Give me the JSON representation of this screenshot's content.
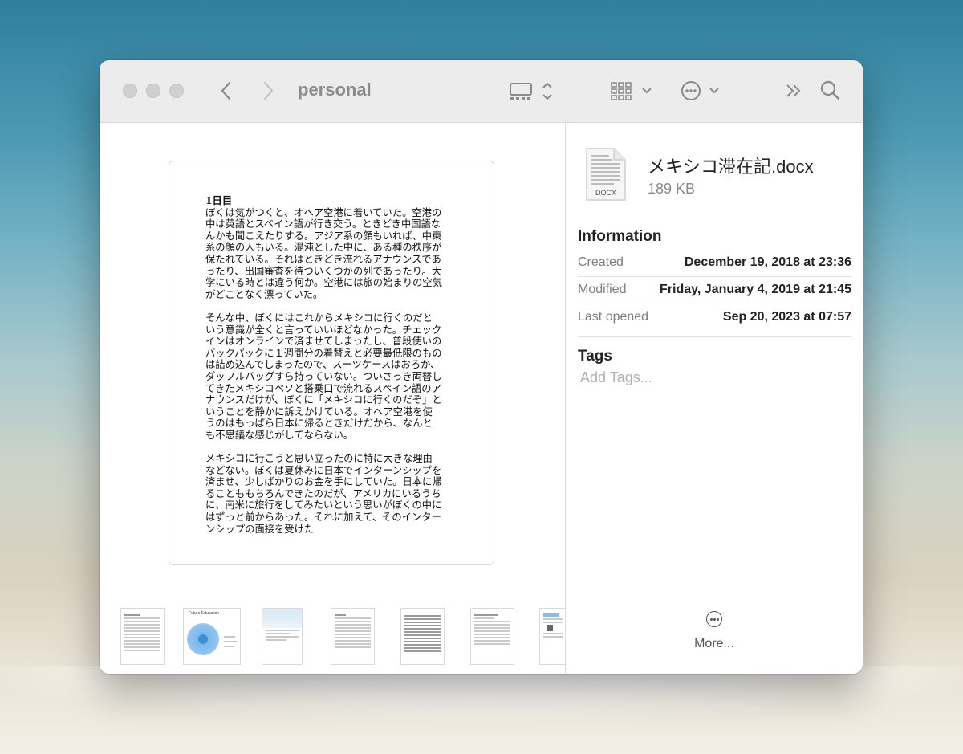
{
  "window": {
    "title": "personal"
  },
  "toolbar": {
    "back_icon": "chevron-left",
    "forward_icon": "chevron-right",
    "view_icon": "gallery-view",
    "group_icon": "grid-group",
    "action_icon": "ellipsis-circle",
    "overflow_icon": "double-chevron-right",
    "search_icon": "magnifying-glass"
  },
  "preview": {
    "heading": "1日目",
    "paragraphs": [
      "ぼくは気がつくと、オヘア空港に着いていた。空港の中は英語とスペイン語が行き交う。ときどき中国語なんかも聞こえたりする。アジア系の顔もいれば、中東系の顔の人もいる。混沌とした中に、ある種の秩序が保たれている。それはときどき流れるアナウンスであったり、出国審査を待ついくつかの列であったり。大学にいる時とは違う何か。空港には旅の始まりの空気がどことなく漂っていた。",
      "そんな中、ぼくにはこれからメキシコに行くのだという意識が全くと言っていいほどなかった。チェックインはオンラインで済ませてしまったし、普段使いのバックパックに１週間分の着替えと必要最低限のものは詰め込んでしまったので、スーツケースはおろか、ダッフルバッグすら持っていない。ついさっき両替してきたメキシコペソと搭乗口で流れるスペイン語のアナウンスだけが、ぼくに「メキシコに行くのだぞ」ということを静かに訴えかけている。オヘア空港を使うのはもっぱら日本に帰るときだけだから、なんとも不思議な感じがしてならない。",
      "メキシコに行こうと思い立ったのに特に大きな理由などない。ぼくは夏休みに日本でインターンシップを済ませ、少しばかりのお金を手にしていた。日本に帰ることももちろんできたのだが、アメリカにいるうちに、南米に旅行をしてみたいという思いがぼくの中にはずっと前からあった。それに加えて、そのインターンシップの面接を受けた"
    ]
  },
  "thumbnails": [
    {
      "name": "thumb-doc-1"
    },
    {
      "name": "thumb-future-education",
      "title": "Future Education"
    },
    {
      "name": "thumb-sky-doc"
    },
    {
      "name": "thumb-doc-4"
    },
    {
      "name": "thumb-doc-5"
    },
    {
      "name": "thumb-doc-6"
    },
    {
      "name": "thumb-doc-7"
    }
  ],
  "inspector": {
    "file_name": "メキシコ滞在記.docx",
    "file_size": "189 KB",
    "file_badge": "DOCX",
    "information_title": "Information",
    "rows": [
      {
        "label": "Created",
        "value": "December 19, 2018 at 23:36"
      },
      {
        "label": "Modified",
        "value": "Friday, January 4, 2019 at 21:45"
      },
      {
        "label": "Last opened",
        "value": "Sep 20, 2023 at 07:57"
      }
    ],
    "tags_title": "Tags",
    "tags_placeholder": "Add Tags...",
    "more_label": "More..."
  }
}
